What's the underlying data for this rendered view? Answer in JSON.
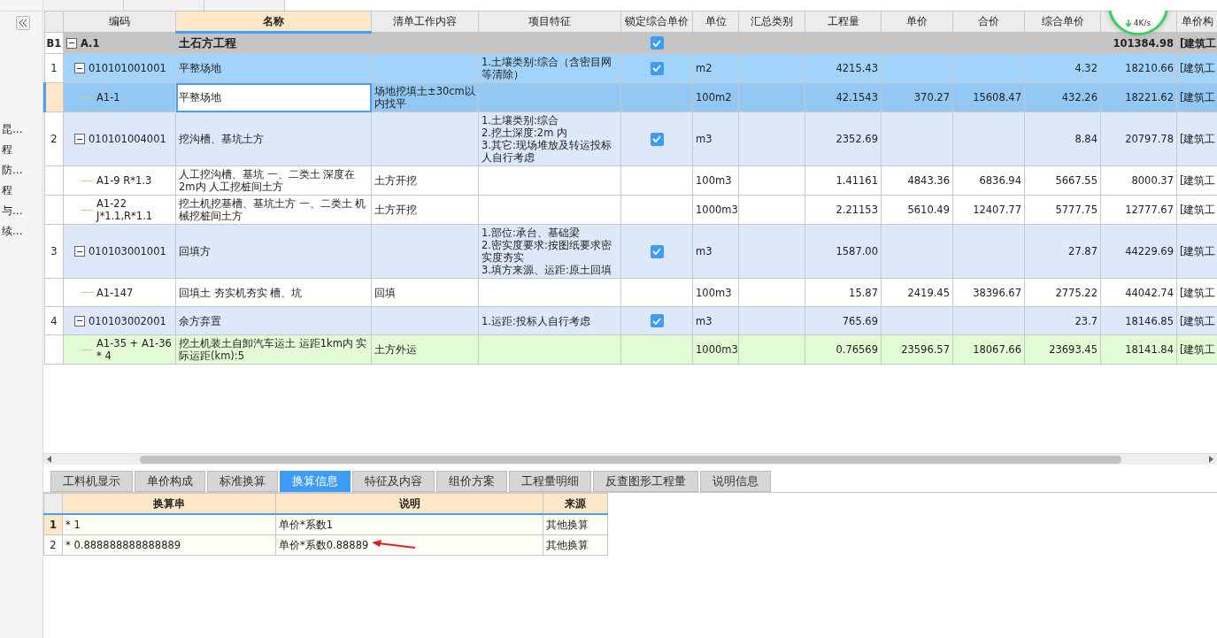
{
  "sidebar": {
    "items": [
      "昆...",
      "程",
      "防...",
      "程",
      "与...",
      "续..."
    ]
  },
  "grid": {
    "columns": [
      {
        "label": "编码",
        "selected": false
      },
      {
        "label": "名称",
        "selected": true
      },
      {
        "label": "清单工作内容",
        "selected": false
      },
      {
        "label": "项目特征",
        "selected": false
      },
      {
        "label": "锁定综合单价",
        "selected": false
      },
      {
        "label": "单位",
        "selected": false
      },
      {
        "label": "汇总类别",
        "selected": false
      },
      {
        "label": "工程量",
        "selected": false
      },
      {
        "label": "单价",
        "selected": false
      },
      {
        "label": "合价",
        "selected": false
      },
      {
        "label": "综合单价",
        "selected": false
      },
      {
        "selected": false
      },
      {
        "label": "单价构",
        "selected": false
      }
    ],
    "rows": [
      {
        "kind": "section",
        "selected": false,
        "num": "B1",
        "code": "A.1",
        "expanded": true,
        "name": "土石方工程",
        "locked": true,
        "combined": "101384.98",
        "build": "[建筑工"
      },
      {
        "kind": "item",
        "selected": true,
        "num": "1",
        "code": "010101001001",
        "expanded": true,
        "name": "平整场地",
        "feature": "1.土壤类别:综合（含密目网等清除）",
        "locked": true,
        "unit": "m2",
        "qty": "4215.43",
        "unit_price": "4.32",
        "combined": "18210.66",
        "build": "[建筑工"
      },
      {
        "kind": "sub",
        "selected": true,
        "code": "A1-1",
        "name": "平整场地",
        "content": "场地挖填土±30cm以内找平",
        "unit": "100m2",
        "qty": "42.1543",
        "price": "370.27",
        "total": "15608.47",
        "unit_price": "432.26",
        "combined": "18221.62",
        "build": "[建筑工"
      },
      {
        "kind": "item",
        "selected": false,
        "num": "2",
        "code": "010101004001",
        "expanded": true,
        "name": "挖沟槽、基坑土方",
        "feature": "1.土壤类别:综合\n2.挖土深度:2m 内\n3.其它:现场堆放及转运投标人自行考虑",
        "locked": true,
        "unit": "m3",
        "qty": "2352.69",
        "unit_price": "8.84",
        "combined": "20797.78",
        "build": "[建筑工"
      },
      {
        "kind": "sub",
        "selected": false,
        "code": "A1-9 R*1.3",
        "name": "人工挖沟槽、基坑 一、二类土 深度在2m内  人工挖桩间土方",
        "content": "土方开挖",
        "unit": "100m3",
        "qty": "1.41161",
        "price": "4843.36",
        "total": "6836.94",
        "unit_price": "5667.55",
        "combined": "8000.37",
        "build": "[建筑工"
      },
      {
        "kind": "sub",
        "selected": false,
        "code": "A1-22 J*1.1,R*1.1",
        "name": "挖土机挖基槽、基坑土方 一、二类土 机械挖桩间土方",
        "content": "土方开挖",
        "unit": "1000m3",
        "qty": "2.21153",
        "price": "5610.49",
        "total": "12407.77",
        "unit_price": "5777.75",
        "combined": "12777.67",
        "build": "[建筑工"
      },
      {
        "kind": "item",
        "selected": false,
        "num": "3",
        "code": "010103001001",
        "expanded": true,
        "name": "回填方",
        "feature": "1.部位:承台、基础梁\n2.密实度要求:按图纸要求密实度夯实\n3.填方来源、运距:原土回填",
        "locked": true,
        "unit": "m3",
        "qty": "1587.00",
        "unit_price": "27.87",
        "combined": "44229.69",
        "build": "[建筑工"
      },
      {
        "kind": "sub",
        "selected": false,
        "code": "A1-147",
        "name": "回填土 夯实机夯实 槽、坑",
        "content": "回填",
        "unit": "100m3",
        "qty": "15.87",
        "price": "2419.45",
        "total": "38396.67",
        "unit_price": "2775.22",
        "combined": "44042.74",
        "build": "[建筑工"
      },
      {
        "kind": "item",
        "selected": false,
        "num": "4",
        "code": "010103002001",
        "expanded": true,
        "name": "余方弃置",
        "feature": "1.运距:投标人自行考虑",
        "locked": true,
        "unit": "m3",
        "qty": "765.69",
        "unit_price": "23.7",
        "combined": "18146.85",
        "build": "[建筑工"
      },
      {
        "kind": "changed_sub",
        "selected": false,
        "code": "A1-35 + A1-36 * 4",
        "name": "挖土机装土自卸汽车运土 运距1km内  实际运距(km):5",
        "content": "土方外运",
        "unit": "1000m3",
        "qty": "0.76569",
        "price": "23596.57",
        "total": "18067.66",
        "unit_price": "23693.45",
        "combined": "18141.84",
        "build": "[建筑工"
      }
    ]
  },
  "tabs": [
    {
      "label": "工料机显示",
      "selected": false
    },
    {
      "label": "单价构成",
      "selected": false
    },
    {
      "label": "标准换算",
      "selected": false
    },
    {
      "label": "换算信息",
      "selected": true
    },
    {
      "label": "特征及内容",
      "selected": false
    },
    {
      "label": "组价方案",
      "selected": false
    },
    {
      "label": "工程量明细",
      "selected": false
    },
    {
      "label": "反查图形工程量",
      "selected": false
    },
    {
      "label": "说明信息",
      "selected": false
    }
  ],
  "detail": {
    "columns": [
      "换算串",
      "说明",
      "来源"
    ],
    "rows": [
      {
        "num": "1",
        "selected": true,
        "expr": "* 1",
        "note": "单价*系数1",
        "source": "其他换算"
      },
      {
        "num": "2",
        "selected": false,
        "expr": "* 0.888888888888889",
        "note": "单价*系数0.88889",
        "source": "其他换算",
        "arrow": true
      }
    ]
  },
  "speed_widget": {
    "rate": "4K/s"
  }
}
